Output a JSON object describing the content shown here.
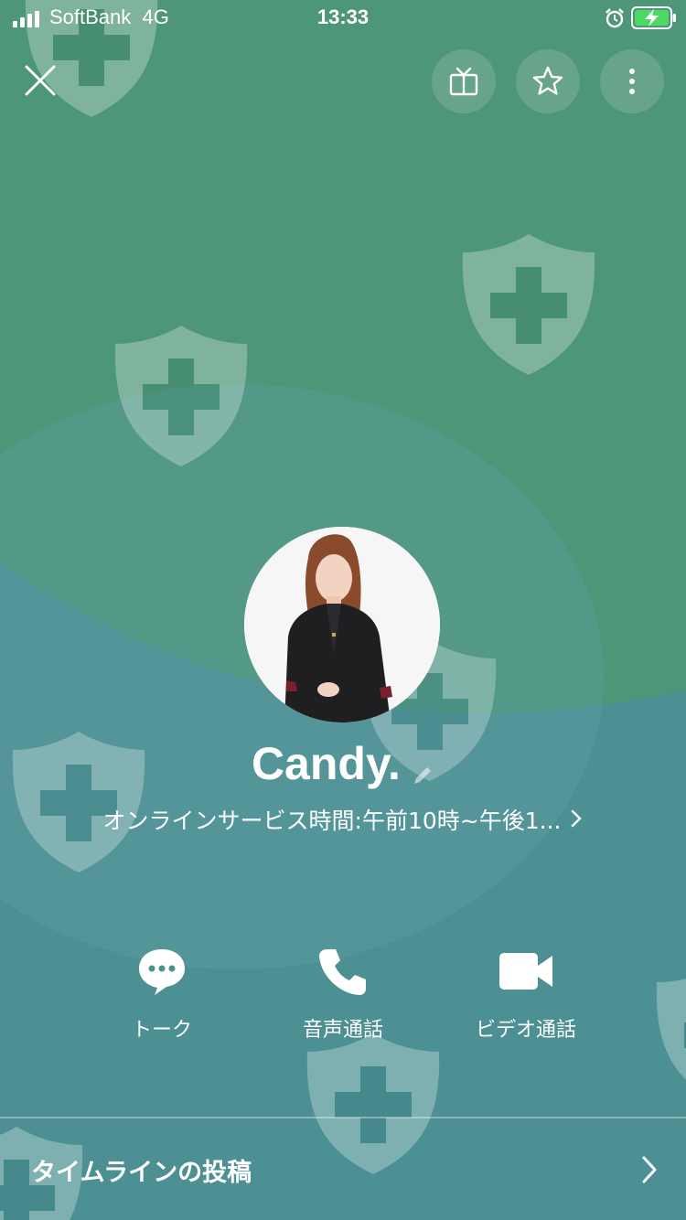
{
  "status_bar": {
    "carrier": "SoftBank",
    "network": "4G",
    "time": "13:33"
  },
  "header": {
    "close_icon": "close-icon",
    "buttons": [
      "gift-icon",
      "star-icon",
      "more-icon"
    ]
  },
  "profile": {
    "name": "Candy.",
    "status_message": "オンラインサービス時間:午前10時~午後1..."
  },
  "actions": [
    {
      "label": "トーク",
      "icon": "chat-bubble-icon"
    },
    {
      "label": "音声通話",
      "icon": "phone-icon"
    },
    {
      "label": "ビデオ通話",
      "icon": "video-camera-icon"
    }
  ],
  "timeline": {
    "label": "タイムラインの投稿"
  },
  "colors": {
    "background_top": "#4e9678",
    "background_bottom": "#4c9093",
    "text": "#ffffff",
    "battery": "#4cd964"
  }
}
